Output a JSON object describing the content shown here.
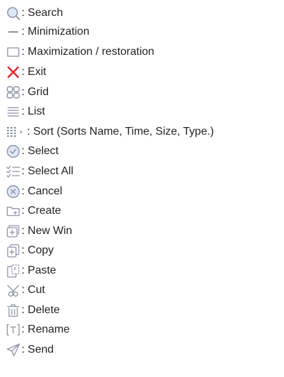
{
  "colors": {
    "icon_stroke": "#8a92a6",
    "icon_fill": "#dfe9f6",
    "exit_red": "#e5262e",
    "text": "#222222"
  },
  "items": [
    {
      "icon": "search-icon",
      "label": ": Search"
    },
    {
      "icon": "minimize-icon",
      "label": ": Minimization"
    },
    {
      "icon": "maximize-icon",
      "label": ": Maximization / restoration"
    },
    {
      "icon": "exit-icon",
      "label": ": Exit"
    },
    {
      "icon": "grid-icon",
      "label": ": Grid"
    },
    {
      "icon": "list-icon",
      "label": ": List"
    },
    {
      "icon": "sort-icon",
      "label": ": Sort (Sorts Name, Time, Size, Type.)"
    },
    {
      "icon": "select-icon",
      "label": ": Select"
    },
    {
      "icon": "select-all-icon",
      "label": ": Select All"
    },
    {
      "icon": "cancel-icon",
      "label": ": Cancel"
    },
    {
      "icon": "create-folder-icon",
      "label": ": Create"
    },
    {
      "icon": "new-window-icon",
      "label": ": New Win"
    },
    {
      "icon": "copy-icon",
      "label": ": Copy"
    },
    {
      "icon": "paste-icon",
      "label": ": Paste"
    },
    {
      "icon": "cut-icon",
      "label": ": Cut"
    },
    {
      "icon": "delete-icon",
      "label": ": Delete"
    },
    {
      "icon": "rename-icon",
      "label": ": Rename"
    },
    {
      "icon": "send-icon",
      "label": ": Send"
    }
  ]
}
